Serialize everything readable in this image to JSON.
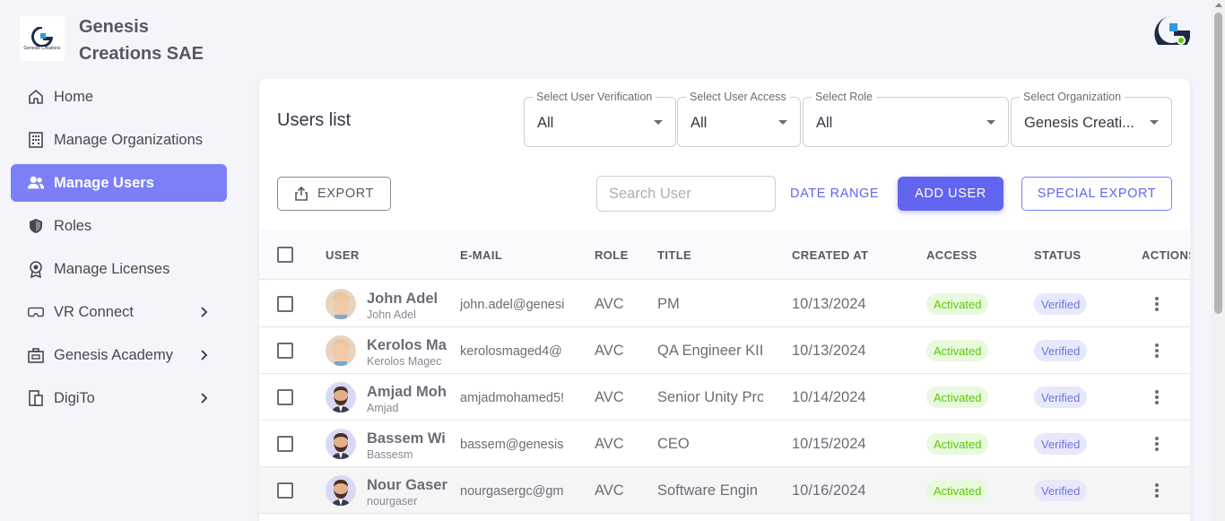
{
  "brand": {
    "name": "Genesis Creations SAE",
    "logo_text": "Genesis Creations"
  },
  "sidebar": {
    "items": [
      {
        "label": "Home",
        "icon": "home-icon"
      },
      {
        "label": "Manage Organizations",
        "icon": "building-icon"
      },
      {
        "label": "Manage Users",
        "icon": "users-icon",
        "active": true
      },
      {
        "label": "Roles",
        "icon": "shield-icon"
      },
      {
        "label": "Manage Licenses",
        "icon": "badge-icon"
      },
      {
        "label": "VR Connect",
        "icon": "vr-headset-icon",
        "expandable": true
      },
      {
        "label": "Genesis Academy",
        "icon": "academy-icon",
        "expandable": true
      },
      {
        "label": "DigiTo",
        "icon": "digito-icon",
        "expandable": true
      }
    ]
  },
  "header": {
    "avatar_icon": "genesis-logo-avatar-icon",
    "online_color": "#56ca00"
  },
  "colors": {
    "accent": "#6265f0",
    "active_nav": "#7c7ff6",
    "activated": "#56ca00",
    "verified": "#7072e8"
  },
  "main": {
    "title": "Users list",
    "filters": {
      "verification": {
        "label": "Select User Verification",
        "value": "All"
      },
      "access": {
        "label": "Select User Access",
        "value": "All"
      },
      "role": {
        "label": "Select Role",
        "value": "All"
      },
      "organization": {
        "label": "Select Organization",
        "value": "Genesis Creati..."
      }
    },
    "toolbar": {
      "export_label": "EXPORT",
      "search_placeholder": "Search User",
      "date_range_label": "DATE RANGE",
      "add_user_label": "ADD USER",
      "special_export_label": "SPECIAL EXPORT"
    },
    "table": {
      "columns": [
        "USER",
        "E-MAIL",
        "ROLE",
        "TITLE",
        "CREATED AT",
        "ACCESS",
        "STATUS",
        "ACTIONS"
      ],
      "rows": [
        {
          "name": "John Adel",
          "sub": "John Adel",
          "email": "john.adel@genesi",
          "role": "AVC",
          "title": "PM",
          "created": "10/13/2024",
          "access": "Activated",
          "status": "Verified",
          "avatar": "blonde"
        },
        {
          "name": "Kerolos Ma",
          "sub": "Kerolos Magec",
          "email": "kerolosmaged4@",
          "role": "AVC",
          "title": "QA Engineer KII",
          "created": "10/13/2024",
          "access": "Activated",
          "status": "Verified",
          "avatar": "blonde"
        },
        {
          "name": "Amjad Moh",
          "sub": "Amjad",
          "email": "amjadmohamed5!",
          "role": "AVC",
          "title": "Senior Unity Pro",
          "created": "10/14/2024",
          "access": "Activated",
          "status": "Verified",
          "avatar": "beard"
        },
        {
          "name": "Bassem Wi",
          "sub": "Bassesm",
          "email": "bassem@genesis",
          "role": "AVC",
          "title": "CEO",
          "created": "10/15/2024",
          "access": "Activated",
          "status": "Verified",
          "avatar": "beard"
        },
        {
          "name": "Nour Gaser",
          "sub": "nourgaser",
          "email": "nourgasergc@gm",
          "role": "AVC",
          "title": "Software Engin",
          "created": "10/16/2024",
          "access": "Activated",
          "status": "Verified",
          "avatar": "beard"
        }
      ]
    }
  }
}
